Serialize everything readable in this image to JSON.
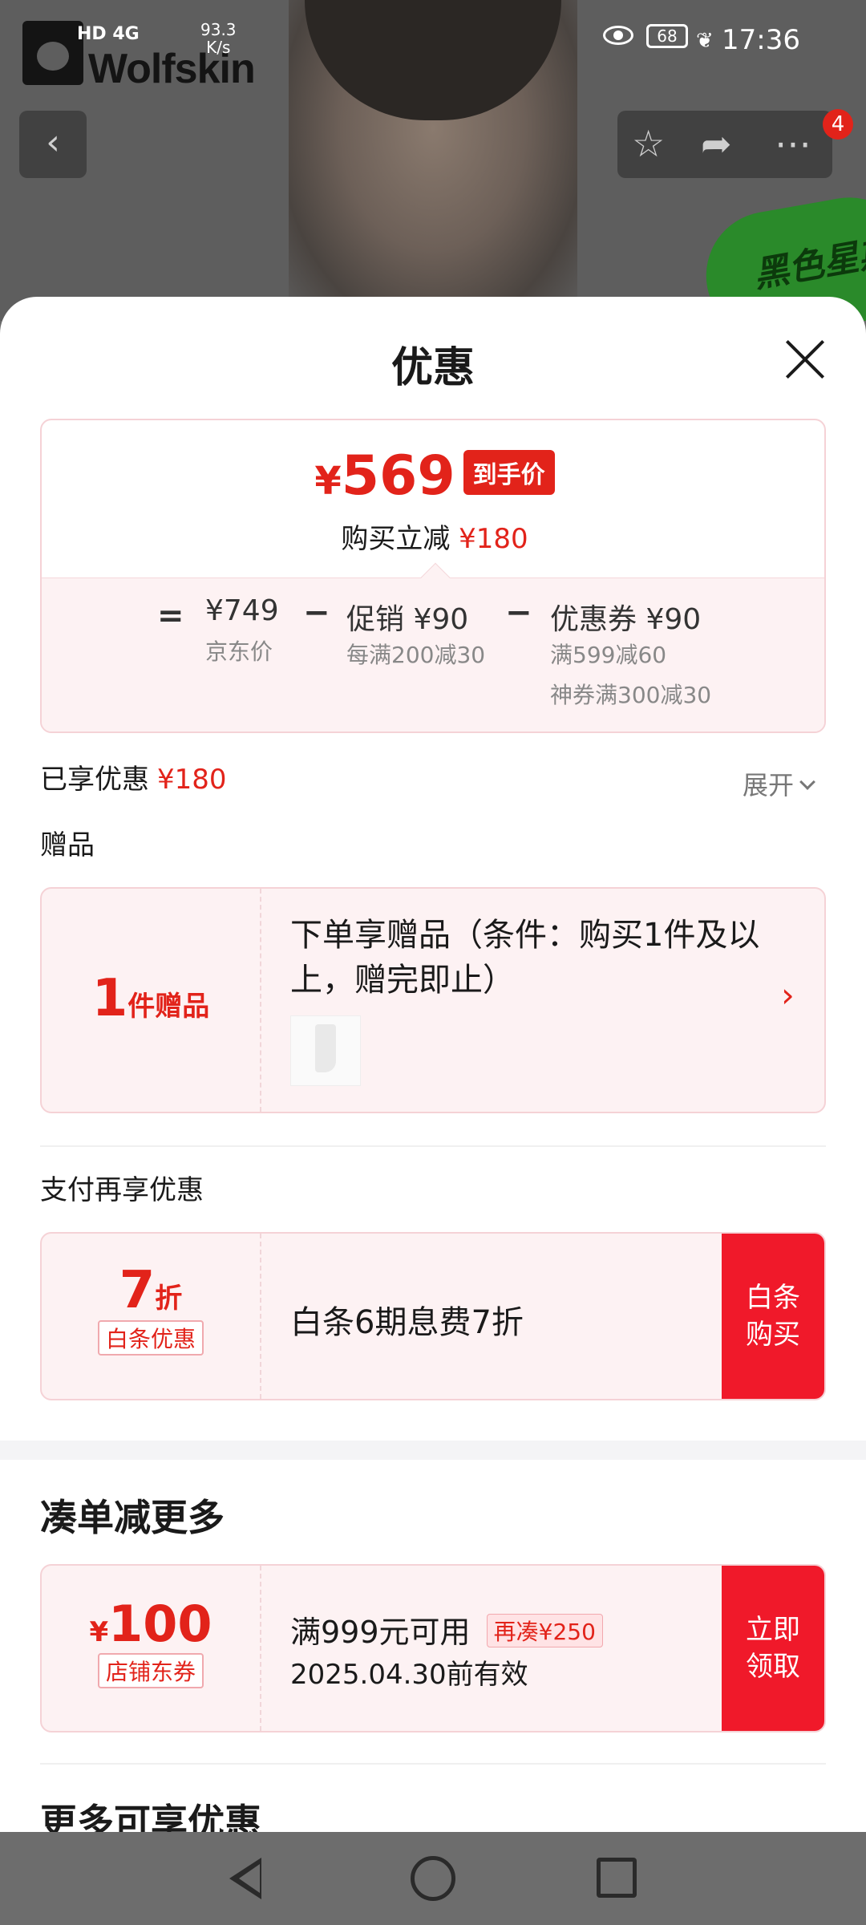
{
  "status_bar": {
    "network_icons": "HD 4G",
    "speed_value": "93.3",
    "speed_unit": "K/s",
    "battery": "68",
    "time": "17:36"
  },
  "background": {
    "brand": "Wolfskin",
    "badge_text": "黑色星期五",
    "notification_count": "4"
  },
  "icons": {
    "back": "chevron-left",
    "star": "star-outline",
    "share": "share-arrow",
    "more": "more-dots"
  },
  "sheet": {
    "title": "优惠",
    "price": {
      "yen": "¥",
      "amount": "569",
      "tag": "到手价",
      "sub_label": "购买立减",
      "sub_value": "¥180"
    },
    "breakdown": {
      "eq": "=",
      "jd_price": "¥749",
      "jd_label": "京东价",
      "minus1": "−",
      "promo_label": "促销",
      "promo_value": "¥90",
      "promo_note": "每满200减30",
      "minus2": "−",
      "coupon_label": "优惠券",
      "coupon_value": "¥90",
      "coupon_note1": "满599减60",
      "coupon_note2": "神券满300减30"
    },
    "saved_label": "已享优惠",
    "saved_value": "¥180",
    "expand_label": "展开",
    "gift_section": "赠品",
    "gift": {
      "count": "1",
      "unit": "件赠品",
      "desc": "下单享赠品（条件：购买1件及以上，赠完即止）",
      "arrow": "›"
    },
    "pay_section": "支付再享优惠",
    "pay": {
      "discount": "7",
      "unit": "折",
      "chip": "白条优惠",
      "desc": "白条6期息费7折",
      "btn": "白条购买"
    },
    "bundle_title": "凑单减更多",
    "bundle": {
      "yen": "¥",
      "amount": "100",
      "chip": "店铺东券",
      "desc": "满999元可用",
      "extra_tag": "再凑¥250",
      "expiry": "2025.04.30前有效",
      "btn": "立即领取"
    },
    "more_title": "更多可享优惠"
  }
}
